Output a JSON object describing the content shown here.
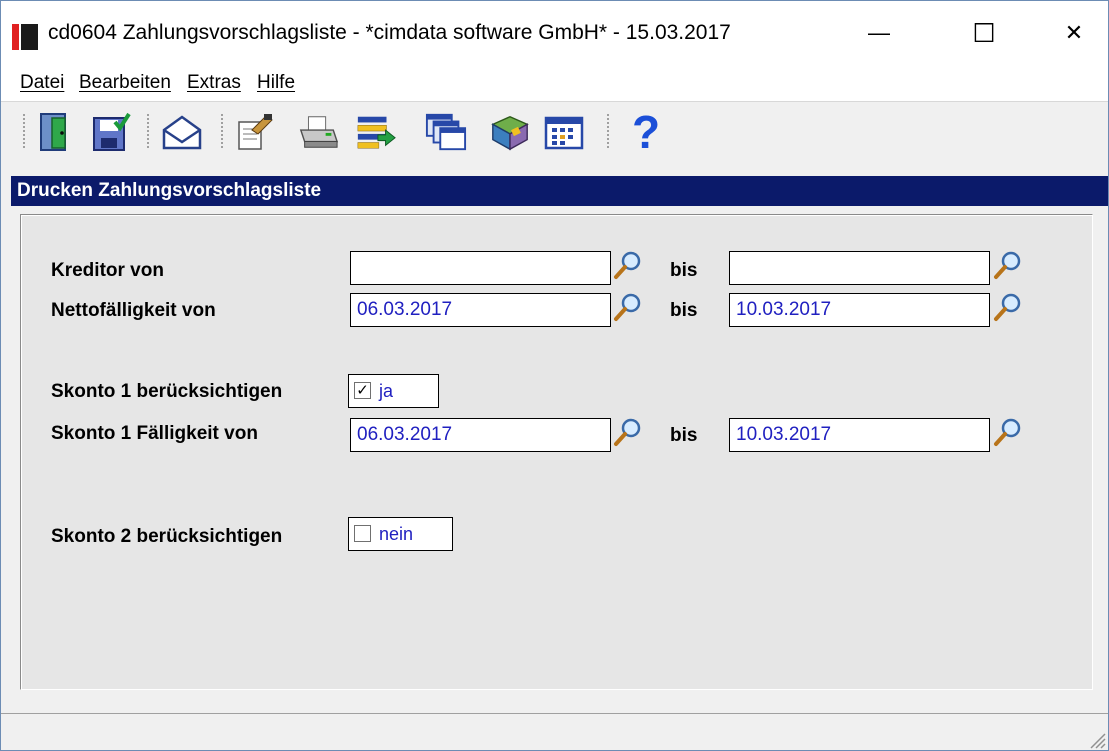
{
  "window": {
    "title": "cd0604 Zahlungsvorschlagsliste - *cimdata software GmbH* - 15.03.2017",
    "minimize_glyph": "—",
    "maximize_glyph": "☐",
    "close_glyph": "✕"
  },
  "menu": {
    "items": [
      {
        "label": "Datei"
      },
      {
        "label": "Bearbeiten"
      },
      {
        "label": "Extras"
      },
      {
        "label": "Hilfe"
      }
    ]
  },
  "toolbar": {
    "buttons": [
      {
        "icon": "exit-door-icon"
      },
      {
        "icon": "save-disk-icon"
      },
      {
        "icon": "email-envelope-icon"
      },
      {
        "icon": "properties-icon"
      },
      {
        "icon": "printer-icon"
      },
      {
        "icon": "list-transfer-icon"
      },
      {
        "icon": "windows-stack-icon"
      },
      {
        "icon": "book-tag-icon"
      },
      {
        "icon": "calendar-grid-icon"
      },
      {
        "icon": "help-question-icon"
      }
    ],
    "help_glyph": "?"
  },
  "panel": {
    "header": "Drucken Zahlungsvorschlagsliste"
  },
  "form": {
    "kreditor_label": "Kreditor von",
    "kreditor_from": "",
    "kreditor_to": "",
    "netto_label": "Nettofälligkeit von",
    "netto_from": "06.03.2017",
    "netto_to": "10.03.2017",
    "bis_label": "bis",
    "skonto1_label": "Skonto 1 berücksichtigen",
    "skonto1_checked": true,
    "skonto1_check_glyph": "✓",
    "skonto1_value": "ja",
    "skonto1_faellig_label": "Skonto 1 Fälligkeit von",
    "skonto1_from": "06.03.2017",
    "skonto1_to": "10.03.2017",
    "skonto2_label": "Skonto 2 berücksichtigen",
    "skonto2_checked": false,
    "skonto2_value": "nein"
  },
  "colors": {
    "header_bg": "#0b1a6a",
    "value_text": "#2020c0",
    "brand_red": "#e02020"
  }
}
